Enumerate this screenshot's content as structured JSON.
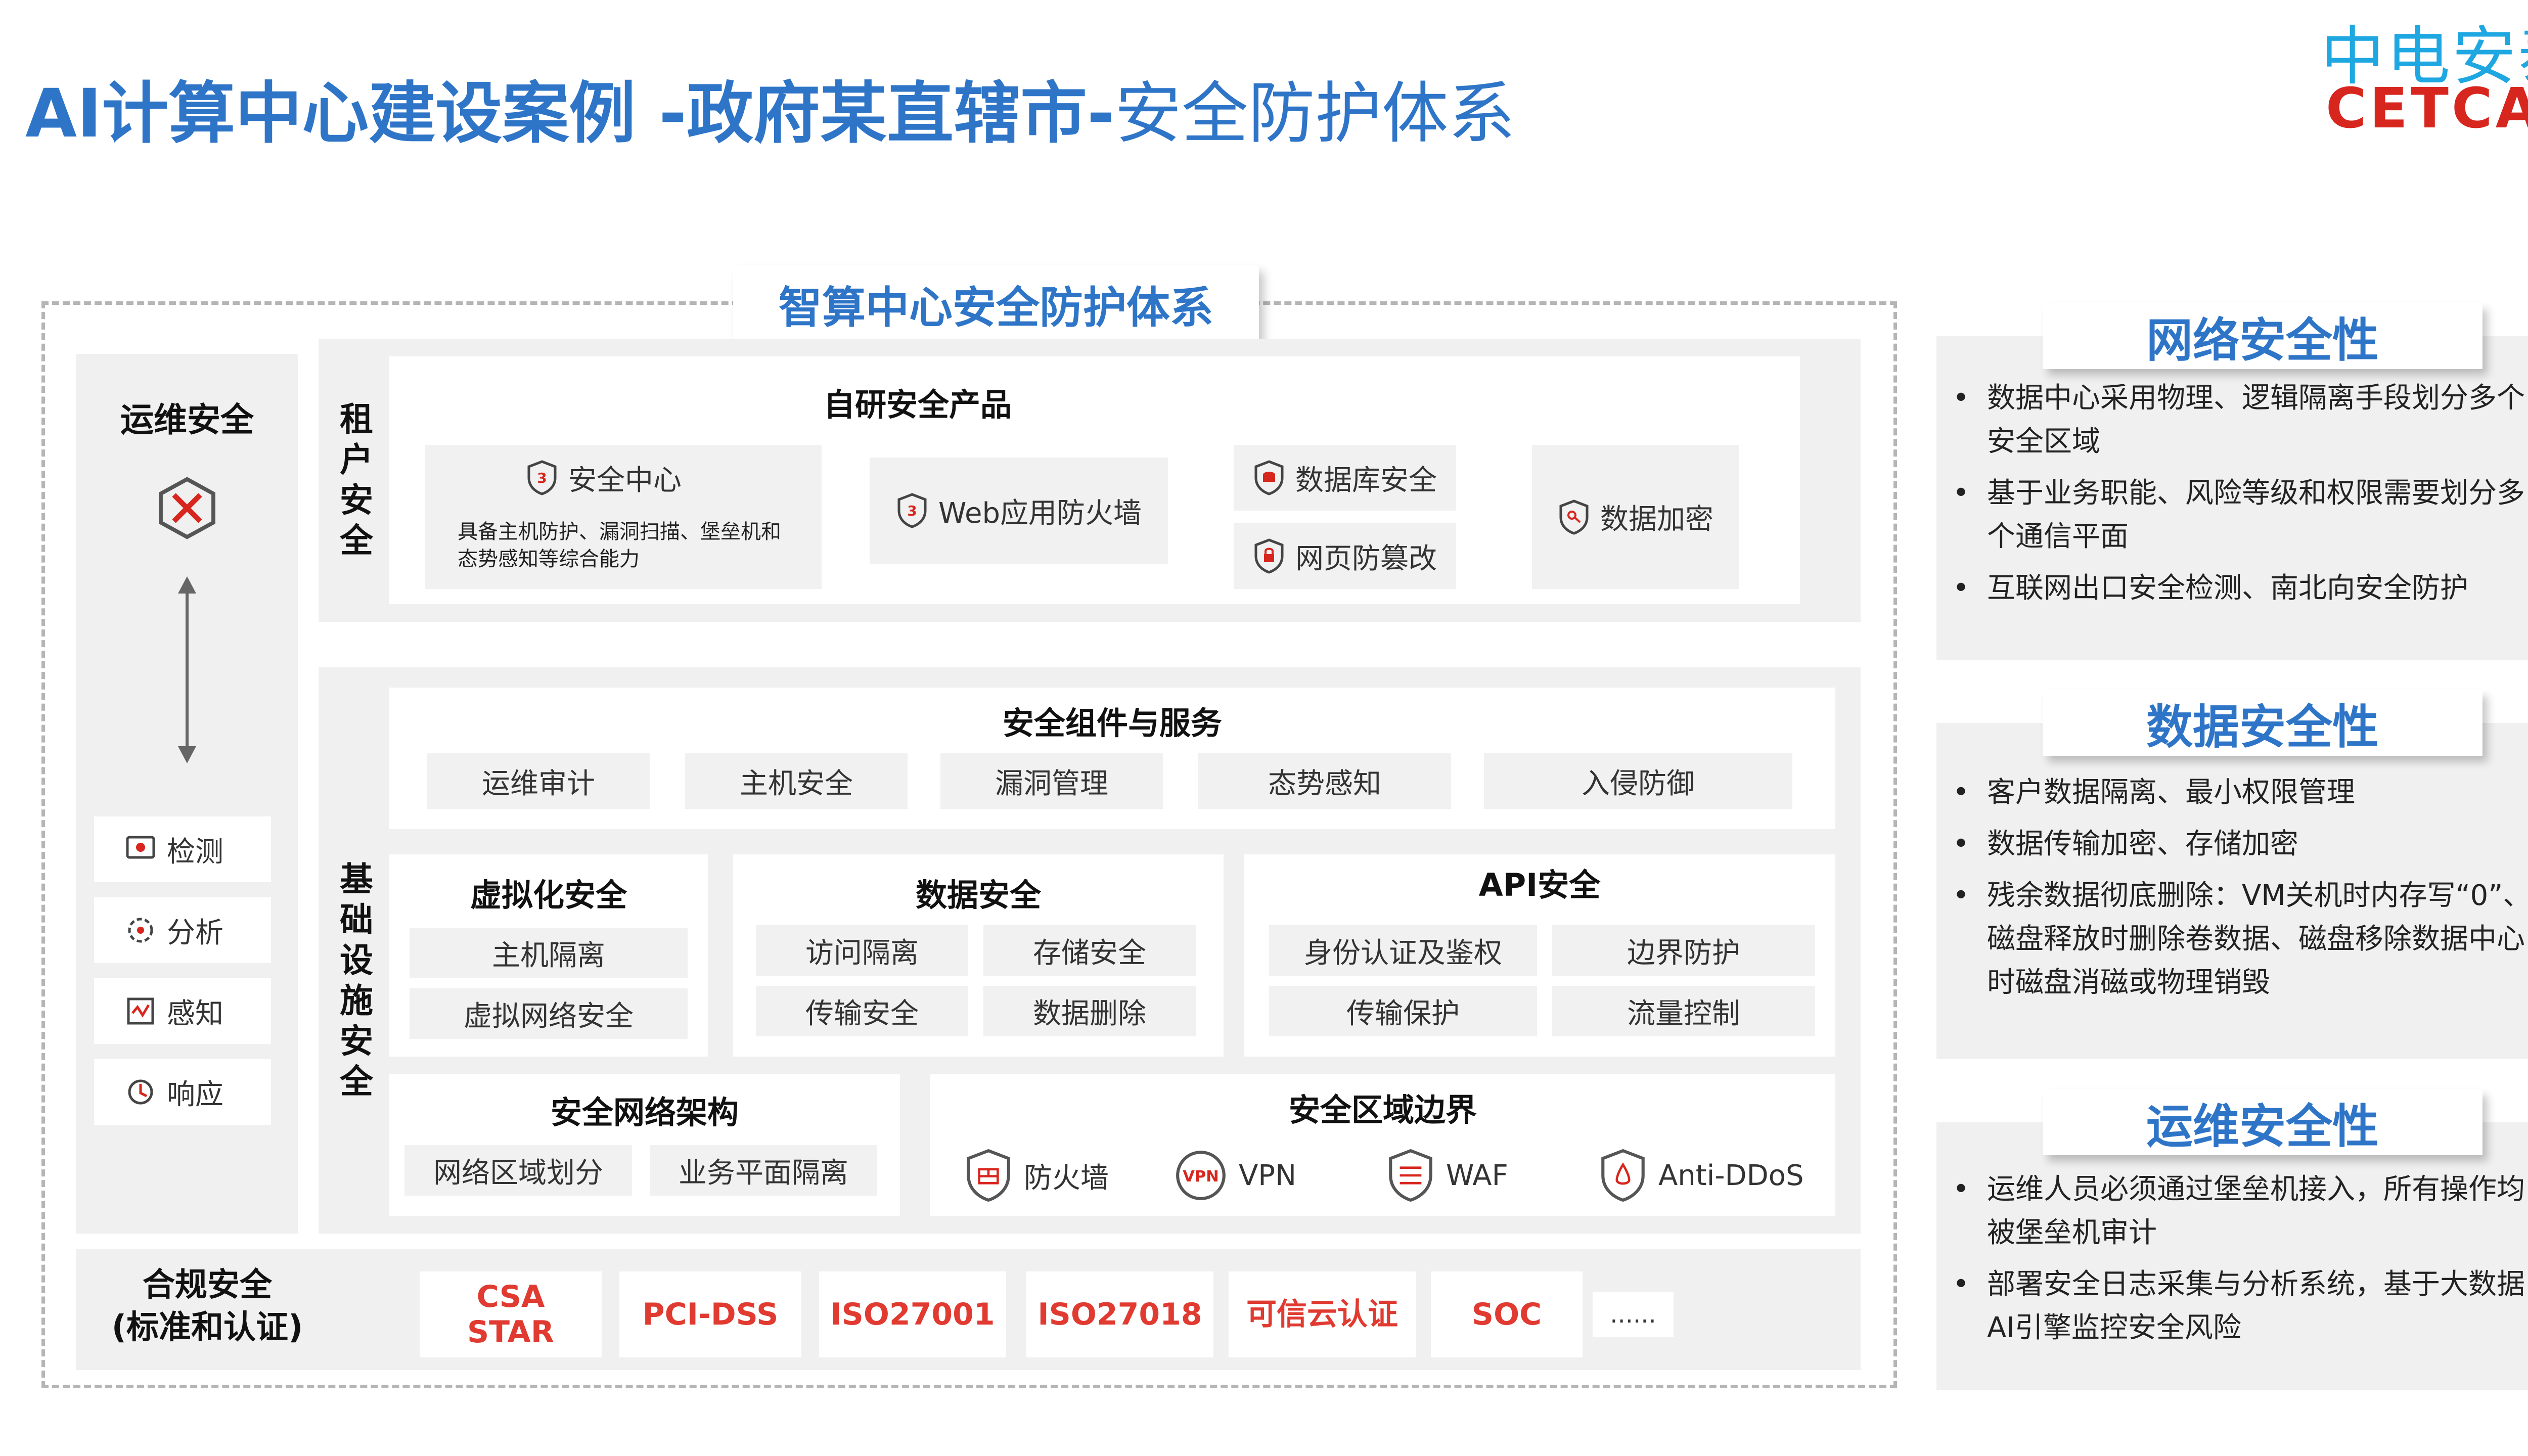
{
  "header": {
    "title_bold": "AI计算中心建设案例 -政府某直辖市-",
    "title_normal": "安全防护体系",
    "logo_cn": "中电安泰",
    "logo_en": "CETCAT"
  },
  "frame_title": "智算中心安全防护体系",
  "ops": {
    "title": "运维安全",
    "items": [
      "检测",
      "分析",
      "感知",
      "响应"
    ]
  },
  "tenant": {
    "label": "租户安全",
    "products_title": "自研安全产品",
    "security_center": "安全中心",
    "security_center_desc": "具备主机防护、漏洞扫描、堡垒机和态势感知等综合能力",
    "waf": "Web应用防火墙",
    "db_security": "数据库安全",
    "anti_tamper": "网页防篡改",
    "encryption": "数据加密"
  },
  "infra": {
    "label": "基础设施安全",
    "components_title": "安全组件与服务",
    "components": [
      "运维审计",
      "主机安全",
      "漏洞管理",
      "态势感知",
      "入侵防御"
    ],
    "virt_title": "虚拟化安全",
    "virt_items": [
      "主机隔离",
      "虚拟网络安全"
    ],
    "data_title": "数据安全",
    "data_items": [
      "访问隔离",
      "存储安全",
      "传输安全",
      "数据删除"
    ],
    "api_title": "API安全",
    "api_items": [
      "身份认证及鉴权",
      "边界防护",
      "传输保护",
      "流量控制"
    ],
    "net_title": "安全网络架构",
    "net_items": [
      "网络区域划分",
      "业务平面隔离"
    ],
    "zone_title": "安全区域边界",
    "zone_items": [
      "防火墙",
      "VPN",
      "WAF",
      "Anti-DDoS"
    ]
  },
  "compliance": {
    "title_line1": "合规安全",
    "title_line2": "(标准和认证)",
    "items": [
      "CSA STAR",
      "PCI-DSS",
      "ISO27001",
      "ISO27018",
      "可信云认证",
      "SOC",
      "......"
    ]
  },
  "side": {
    "network": {
      "title": "网络安全性",
      "points": [
        "数据中心采用物理、逻辑隔离手段划分多个安全区域",
        "基于业务职能、风险等级和权限需要划分多个通信平面",
        "互联网出口安全检测、南北向安全防护"
      ]
    },
    "data": {
      "title": "数据安全性",
      "points": [
        "客户数据隔离、最小权限管理",
        "数据传输加密、存储加密",
        "残余数据彻底删除：VM关机时内存写“0”、磁盘释放时删除卷数据、磁盘移除数据中心时磁盘消磁或物理销毁"
      ]
    },
    "ops": {
      "title": "运维安全性",
      "points": [
        "运维人员必须通过堡垒机接入，所有操作均被堡垒机审计",
        "部署安全日志采集与分析系统，基于大数据AI引擎监控安全风险"
      ]
    }
  },
  "colors": {
    "accent": "#2e75c8",
    "red": "#e03a31",
    "panel": "#f0f0f0"
  }
}
